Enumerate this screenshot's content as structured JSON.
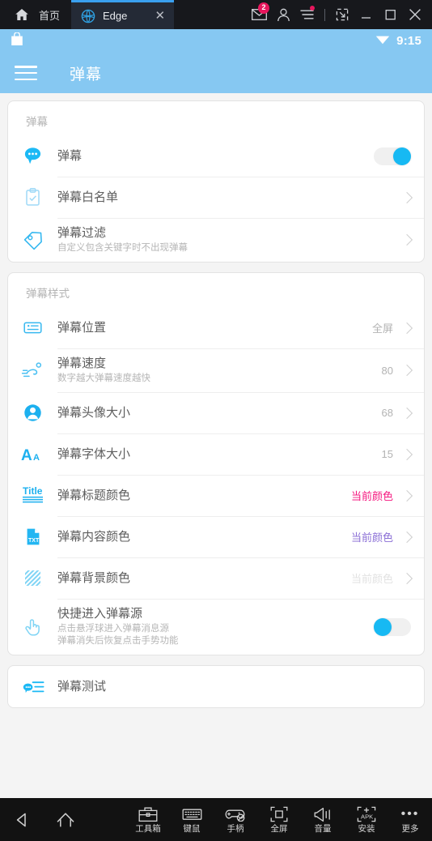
{
  "titlebar": {
    "home_label": "首页",
    "home_icon": "home-icon",
    "tab": {
      "label": "Edge",
      "icon": "edge-browser-icon",
      "close": "✕"
    },
    "mail_icon": "mail-icon",
    "mail_badge": "2",
    "account_icon": "account-icon",
    "menu_icon": "menu-lines-icon",
    "popout_icon": "popout-icon",
    "minimize_icon": "minimize-icon",
    "maximize_icon": "maximize-icon",
    "close_icon": "close-icon"
  },
  "statusbar": {
    "app_icon": "bag-icon",
    "wifi_icon": "wifi-icon",
    "time": "9:15"
  },
  "appbar": {
    "menu_icon": "hamburger-icon",
    "title": "弹幕"
  },
  "sections": [
    {
      "title": "弹幕",
      "rows": [
        {
          "icon": "chat-bubble-icon",
          "title": "弹幕",
          "sub": "",
          "value": "",
          "control": "toggle-on",
          "chevron": false
        },
        {
          "icon": "clipboard-check-icon",
          "title": "弹幕白名单",
          "sub": "",
          "value": "",
          "control": "none",
          "chevron": true
        },
        {
          "icon": "tag-icon",
          "title": "弹幕过滤",
          "sub": "自定义包含关键字时不出现弹幕",
          "value": "",
          "control": "none",
          "chevron": true
        }
      ]
    },
    {
      "title": "弹幕样式",
      "rows": [
        {
          "icon": "list-card-icon",
          "title": "弹幕位置",
          "sub": "",
          "value": "全屏",
          "value_style": "gray",
          "control": "none",
          "chevron": true
        },
        {
          "icon": "runner-icon",
          "title": "弹幕速度",
          "sub": "数字越大弹幕速度越快",
          "value": "80",
          "value_style": "gray",
          "control": "none",
          "chevron": true
        },
        {
          "icon": "avatar-icon",
          "title": "弹幕头像大小",
          "sub": "",
          "value": "68",
          "value_style": "gray",
          "control": "none",
          "chevron": true
        },
        {
          "icon": "font-size-icon",
          "title": "弹幕字体大小",
          "sub": "",
          "value": "15",
          "value_style": "gray",
          "control": "none",
          "chevron": true
        },
        {
          "icon": "title-text-icon",
          "title": "弹幕标题颜色",
          "sub": "",
          "value": "当前颜色",
          "value_style": "pink",
          "control": "none",
          "chevron": true
        },
        {
          "icon": "txt-file-icon",
          "title": "弹幕内容颜色",
          "sub": "",
          "value": "当前颜色",
          "value_style": "purple",
          "control": "none",
          "chevron": true
        },
        {
          "icon": "hatch-pattern-icon",
          "title": "弹幕背景颜色",
          "sub": "",
          "value": "当前颜色",
          "value_style": "faint",
          "control": "none",
          "chevron": true
        },
        {
          "icon": "tap-hand-icon",
          "title": "快捷进入弹幕源",
          "sub": "点击悬浮球进入弹幕消息源\n弹幕消失后恢复点击手势功能",
          "value": "",
          "control": "toggle-off",
          "chevron": false
        }
      ]
    },
    {
      "title": "",
      "rows": [
        {
          "icon": "danmaku-test-icon",
          "title": "弹幕测试",
          "sub": "",
          "value": "",
          "control": "none",
          "chevron": false
        }
      ]
    }
  ],
  "navbar": {
    "back_icon": "back-triangle-icon",
    "home_icon": "home-outline-icon",
    "items": [
      {
        "icon": "toolbox-icon",
        "label": "工具箱"
      },
      {
        "icon": "keyboard-icon",
        "label": "键鼠"
      },
      {
        "icon": "gamepad-icon",
        "label": "手柄"
      },
      {
        "icon": "fullscreen-icon",
        "label": "全屏"
      },
      {
        "icon": "volume-icon",
        "label": "音量"
      },
      {
        "icon": "apk-install-icon",
        "label": "安装"
      },
      {
        "icon": "more-dots-icon",
        "label": "更多"
      }
    ]
  },
  "colors": {
    "accent_blue": "#17b9f3",
    "header_blue": "#86c8f2",
    "pink": "#f5177f",
    "purple": "#8b6fd6",
    "bg": "#f4f4f4"
  }
}
